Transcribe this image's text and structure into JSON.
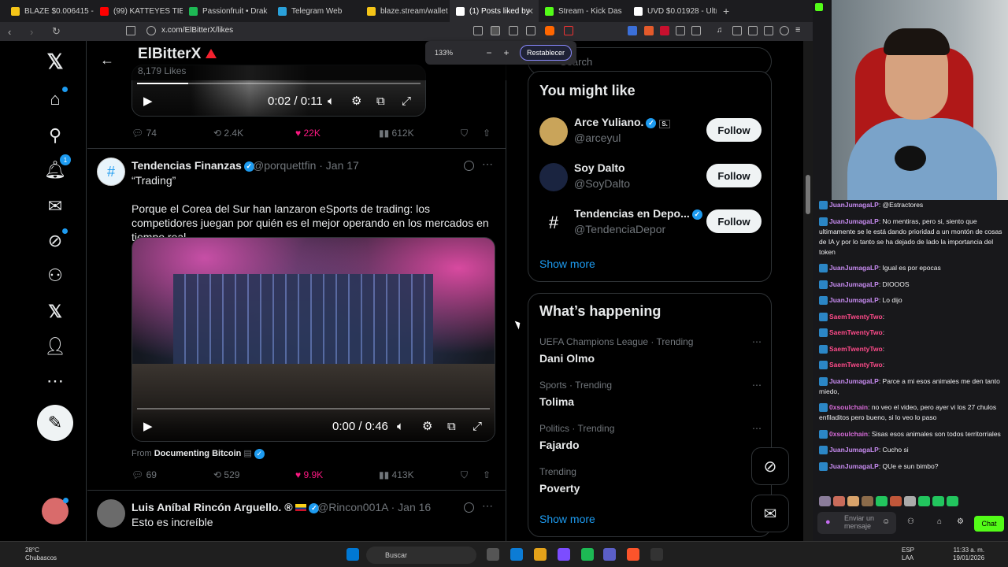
{
  "browser": {
    "tabs": [
      {
        "label": "BLAZE $0.006415 - BL",
        "color": "#f5c518"
      },
      {
        "label": "(99) KATTEYES TIENE",
        "color": "#ff0000"
      },
      {
        "label": "Passionfruit • Drak",
        "color": "#1db954"
      },
      {
        "label": "Telegram Web",
        "color": "#2aa1da"
      },
      {
        "label": "blaze.stream/wallet",
        "color": "#f5c518"
      },
      {
        "label": "(1) Posts liked by",
        "color": "#ffffff"
      },
      {
        "label": "Stream - Kick Das",
        "color": "#53fc18"
      },
      {
        "label": "UVD $0.01928 - Ultra",
        "color": "#ffffff"
      }
    ],
    "url": "x.com/ElBitterX/likes",
    "zoom": {
      "percent": "133%",
      "minus": "−",
      "plus": "+",
      "reset": "Restablecer"
    }
  },
  "x": {
    "nav_icons": [
      "x-logo-icon",
      "home-icon",
      "search-icon",
      "notifications-icon",
      "messages-icon",
      "grok-icon",
      "communities-icon",
      "x-premium-icon",
      "profile-icon",
      "more-icon"
    ],
    "notif_count": "1",
    "header": {
      "back": "←",
      "name": "ElBitterX",
      "likes": "8,179 Likes"
    },
    "post1": {
      "time": "0:02 / 0:11",
      "replies": "74",
      "reposts": "2.4K",
      "likes": "22K",
      "views": "612K"
    },
    "post2": {
      "name": "Tendencias Finanzas",
      "handle": "@porquettfin · Jan 17",
      "text1": "“Trading”",
      "text2": "Porque el Corea del Sur han lanzaron eSports de trading: los competidores juegan por quién es el mejor operando en los mercados en tiempo real",
      "time": "0:00 / 0:46",
      "from_label": "From",
      "from_source": "Documenting Bitcoin",
      "replies": "69",
      "reposts": "529",
      "likes": "9.9K",
      "views": "413K"
    },
    "post3": {
      "name": "Luis Aníbal Rincón Arguello. ®",
      "handle": "@Rincon001A · Jan 16",
      "text": "Esto es increíble"
    },
    "search_placeholder": "Search",
    "you_might_like": {
      "title": "You might like",
      "items": [
        {
          "name": "Arce Yuliano.",
          "badge": "S.",
          "handle": "@arceyul",
          "button": "Follow"
        },
        {
          "name": "Soy Dalto",
          "handle": "@SoyDalto",
          "button": "Follow"
        },
        {
          "name": "Tendencias en Depo...",
          "handle": "@TendenciaDepor",
          "button": "Follow"
        }
      ],
      "show_more": "Show more"
    },
    "whats_happening": {
      "title": "What’s happening",
      "items": [
        {
          "context": "UEFA Champions League · Trending",
          "topic": "Dani Olmo"
        },
        {
          "context": "Sports · Trending",
          "topic": "Tolima"
        },
        {
          "context": "Politics · Trending",
          "topic": "Fajardo"
        },
        {
          "context": "Trending",
          "topic": "Poverty"
        }
      ],
      "show_more": "Show more"
    }
  },
  "kick_chat": {
    "messages": [
      {
        "user": "JuanJumagaLP",
        "color": "#c88cf2",
        "text": ": @Estractores"
      },
      {
        "user": "JuanJumagaLP",
        "color": "#c88cf2",
        "text": ": No mentiras, pero si, siento que ultimamente se le está dando prioridad a un montón de cosas de IA y por lo tanto se ha dejado de lado la importancia del token"
      },
      {
        "user": "JuanJumagaLP",
        "color": "#c88cf2",
        "text": ": Igual es por epocas"
      },
      {
        "user": "JuanJumagaLP",
        "color": "#c88cf2",
        "text": ": DIOOOS"
      },
      {
        "user": "JuanJumagaLP",
        "color": "#c88cf2",
        "text": ": Lo dijo"
      },
      {
        "user": "SaemTwentyTwo",
        "color": "#ff4b8a",
        "text": ":"
      },
      {
        "user": "SaemTwentyTwo",
        "color": "#ff4b8a",
        "text": ":"
      },
      {
        "user": "SaemTwentyTwo",
        "color": "#ff4b8a",
        "text": ":"
      },
      {
        "user": "SaemTwentyTwo",
        "color": "#ff4b8a",
        "text": ":"
      },
      {
        "user": "JuanJumagaLP",
        "color": "#c88cf2",
        "text": ": Parce a mi esos animales me den tanto miedo,"
      },
      {
        "user": "0xsoulchain",
        "color": "#d66bd8",
        "text": ": no veo el video, pero ayer vi los 27 chulos enfiladitos pero bueno, si lo veo lo paso"
      },
      {
        "user": "0xsoulchain",
        "color": "#d66bd8",
        "text": ": Sisas esos animales son todos territorriales"
      },
      {
        "user": "JuanJumagaLP",
        "color": "#c88cf2",
        "text": ": Cucho si"
      },
      {
        "user": "JuanJumagaLP",
        "color": "#c88cf2",
        "text": ": QUe e sun bimbo?"
      }
    ],
    "input_placeholder": "Enviar un mensaje",
    "chat_button": "Chat"
  },
  "taskbar": {
    "weather_temp": "28°C",
    "weather_desc": "Chubascos",
    "search": "Buscar",
    "lang1": "ESP",
    "lang2": "LAA",
    "time": "11:33 a. m.",
    "date": "19/01/2026"
  }
}
